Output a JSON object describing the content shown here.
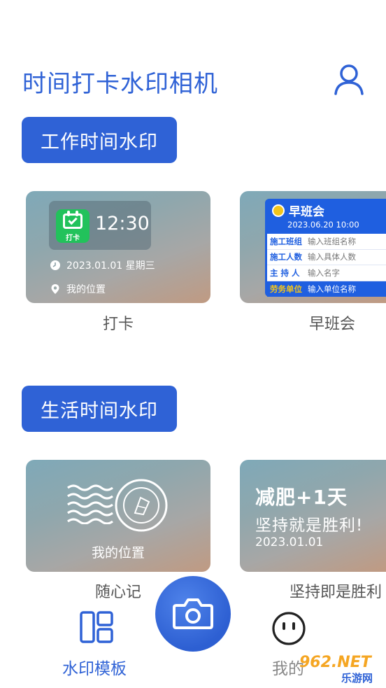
{
  "app": {
    "title": "时间打卡水印相机"
  },
  "sections": {
    "work": {
      "label": "工作时间水印"
    },
    "life": {
      "label": "生活时间水印"
    }
  },
  "cards": {
    "punch": {
      "label": "打卡",
      "badge": "打卡",
      "time": "12:30",
      "date": "2023.01.01 星期三",
      "location": "我的位置"
    },
    "meeting": {
      "label": "早班会",
      "title": "早班会",
      "datetime": "2023.06.20 10:00",
      "rows": [
        {
          "key": "施工班组",
          "value": "输入班组名称"
        },
        {
          "key": "施工人数",
          "value": "输入具体人数"
        },
        {
          "key": "主 持 人",
          "value": "输入名字"
        },
        {
          "key": "劳务单位",
          "value": "输入单位名称"
        }
      ]
    },
    "journal": {
      "label": "随心记",
      "location": "我的位置"
    },
    "diet": {
      "label": "坚持即是胜利",
      "line1": "减肥+1天",
      "line2": "坚持就是胜利!",
      "date": "2023.01.01"
    }
  },
  "tabs": {
    "templates": {
      "label": "水印模板"
    },
    "mine": {
      "label": "我的"
    }
  },
  "watermark": {
    "text": "962.NET",
    "sub": "乐游网"
  },
  "colors": {
    "accent": "#2f62d6",
    "green": "#22c25b",
    "meetingBlue": "#1f5fe0",
    "yellow": "#f3c51b"
  }
}
